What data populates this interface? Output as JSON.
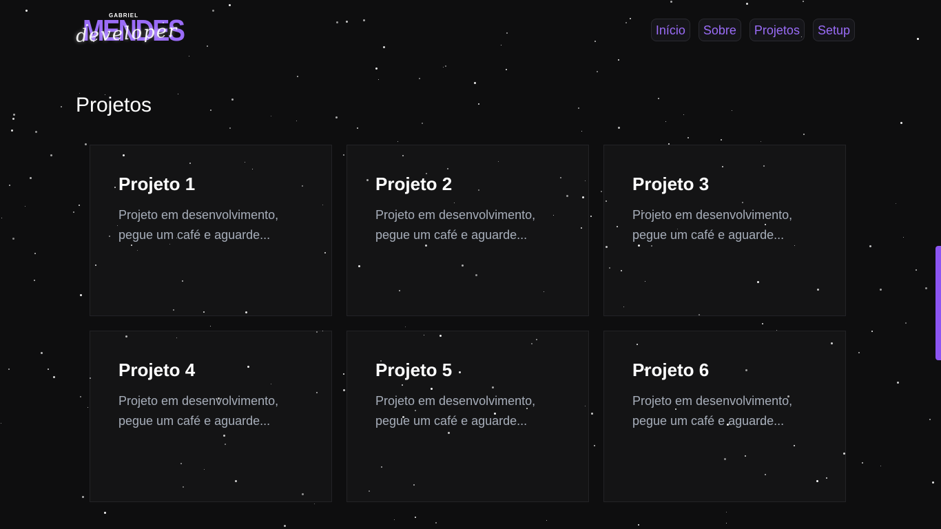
{
  "header": {
    "logo": {
      "top_text": "GABRIEL",
      "main_text": "MENDES",
      "script_text": "developer"
    },
    "nav": [
      {
        "label": "Início"
      },
      {
        "label": "Sobre"
      },
      {
        "label": "Projetos"
      },
      {
        "label": "Setup"
      }
    ]
  },
  "main": {
    "title": "Projetos",
    "projects": [
      {
        "title": "Projeto 1",
        "description": "Projeto em desenvolvimento, pegue um café e aguarde..."
      },
      {
        "title": "Projeto 2",
        "description": "Projeto em desenvolvimento, pegue um café e aguarde..."
      },
      {
        "title": "Projeto 3",
        "description": "Projeto em desenvolvimento, pegue um café e aguarde..."
      },
      {
        "title": "Projeto 4",
        "description": "Projeto em desenvolvimento, pegue um café e aguarde..."
      },
      {
        "title": "Projeto 5",
        "description": "Projeto em desenvolvimento, pegue um café e aguarde..."
      },
      {
        "title": "Projeto 6",
        "description": "Projeto em desenvolvimento, pegue um café e aguarde..."
      }
    ]
  },
  "colors": {
    "background": "#0e0e0f",
    "accent": "#9a6cf7",
    "card": "#141415",
    "text_muted": "#a7aeba"
  }
}
